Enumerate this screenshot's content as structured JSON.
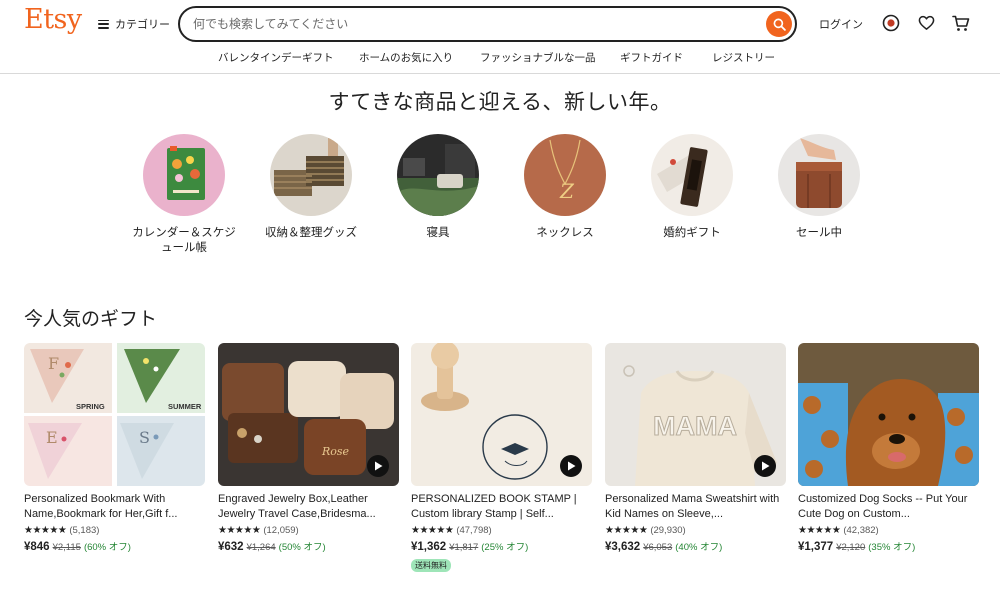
{
  "header": {
    "logo": "Etsy",
    "categories_label": "カテゴリー",
    "search_placeholder": "何でも検索してみてください",
    "login_label": "ログイン",
    "brand_color": "#F1641E",
    "icons": [
      "search-icon",
      "target-icon",
      "heart-icon",
      "cart-icon"
    ]
  },
  "subnav": [
    "バレンタインデーギフト",
    "ホームのお気に入り",
    "ファッショナブルな一品",
    "ギフトガイド",
    "レジストリー"
  ],
  "hero": {
    "title": "すてきな商品と迎える、新しい年。",
    "categories": [
      {
        "label": "カレンダー＆スケジュール帳"
      },
      {
        "label": "収納＆整理グッズ"
      },
      {
        "label": "寝具"
      },
      {
        "label": "ネックレス"
      },
      {
        "label": "婚約ギフト"
      },
      {
        "label": "セール中"
      }
    ]
  },
  "gifts": {
    "title": "今人気のギフト",
    "items": [
      {
        "title": "Personalized Bookmark With Name,Bookmark for Her,Gift f...",
        "stars": "★★★★★",
        "count": "(5,183)",
        "price": "¥846",
        "old": "¥2,115",
        "off": "(60% オフ)",
        "badge": "",
        "thumb_labels": [
          "SPRING",
          "SUMMER"
        ]
      },
      {
        "title": "Engraved Jewelry Box,Leather Jewelry Travel Case,Bridesma...",
        "stars": "★★★★★",
        "count": "(12,059)",
        "price": "¥632",
        "old": "¥1,264",
        "off": "(50% オフ)",
        "badge": ""
      },
      {
        "title": "PERSONALIZED BOOK STAMP | Custom library Stamp | Self...",
        "stars": "★★★★★",
        "count": "(47,798)",
        "price": "¥1,362",
        "old": "¥1,817",
        "off": "(25% オフ)",
        "badge": "送料無料"
      },
      {
        "title": "Personalized Mama Sweatshirt with Kid Names on Sleeve,...",
        "stars": "★★★★★",
        "count": "(29,930)",
        "price": "¥3,632",
        "old": "¥6,053",
        "off": "(40% オフ)",
        "badge": "",
        "thumb_text": "MAMA"
      },
      {
        "title": "Customized Dog Socks -- Put Your Cute Dog on Custom...",
        "stars": "★★★★★",
        "count": "(42,382)",
        "price": "¥1,377",
        "old": "¥2,120",
        "off": "(35% オフ)",
        "badge": ""
      }
    ]
  }
}
